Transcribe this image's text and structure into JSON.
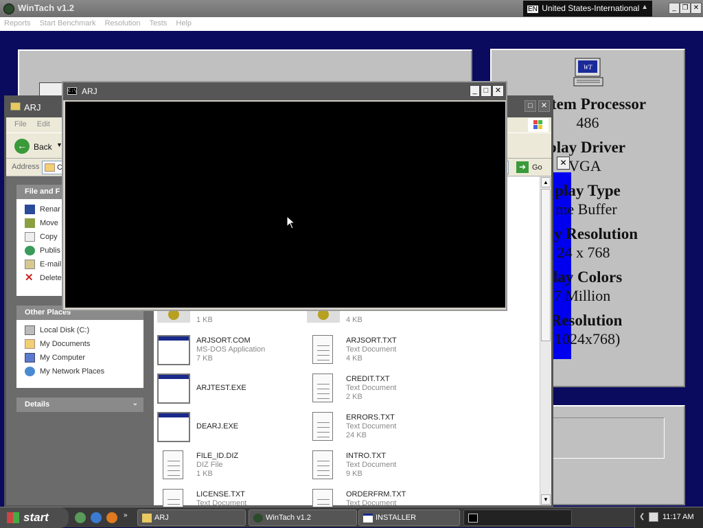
{
  "wintach": {
    "title": "WinTach v1.2",
    "language": "United States-International",
    "lang_code": "EN",
    "menu": [
      "Reports",
      "Start Benchmark",
      "Resolution",
      "Tests",
      "Help"
    ],
    "logo_text": "WT",
    "sysinfo": [
      {
        "heading": "tem Processor",
        "value": "486"
      },
      {
        "heading": "splay Driver",
        "value": "VGA"
      },
      {
        "heading": "play Type",
        "value": "me Buffer"
      },
      {
        "heading": "y Resolution",
        "value": "24 x 768"
      },
      {
        "heading": "lay Colors",
        "value": "7 Million"
      },
      {
        "heading": "Resolution",
        "value": "(1024x768)"
      }
    ]
  },
  "explorer": {
    "title": "ARJ",
    "menu": [
      "File",
      "Edit"
    ],
    "back_label": "Back",
    "address_label": "Address",
    "address_value": "C",
    "go_label": "Go",
    "file_folder_tasks": {
      "title": "File and F",
      "items": [
        "Renar",
        "Move",
        "Copy",
        "Publis",
        "E-mail",
        "Delete"
      ]
    },
    "other_places": {
      "title": "Other Places",
      "items": [
        "Local Disk (C:)",
        "My Documents",
        "My Computer",
        "My Network Places"
      ]
    },
    "details_title": "Details",
    "files": [
      {
        "name": "",
        "type": "",
        "size": "1 KB",
        "icon": "gear"
      },
      {
        "name": "",
        "type": "",
        "size": "4 KB",
        "icon": "gear"
      },
      {
        "name": "ARJSORT.COM",
        "type": "MS-DOS Application",
        "size": "7 KB",
        "icon": "exe"
      },
      {
        "name": "ARJSORT.TXT",
        "type": "Text Document",
        "size": "4 KB",
        "icon": "txt"
      },
      {
        "name": "ARJTEST.EXE",
        "type": "",
        "size": "",
        "icon": "exe"
      },
      {
        "name": "CREDIT.TXT",
        "type": "Text Document",
        "size": "2 KB",
        "icon": "txt"
      },
      {
        "name": "DEARJ.EXE",
        "type": "",
        "size": "",
        "icon": "exe"
      },
      {
        "name": "ERRORS.TXT",
        "type": "Text Document",
        "size": "24 KB",
        "icon": "txt"
      },
      {
        "name": "FILE_ID.DIZ",
        "type": "DIZ File",
        "size": "1 KB",
        "icon": "txt"
      },
      {
        "name": "INTRO.TXT",
        "type": "Text Document",
        "size": "9 KB",
        "icon": "txt"
      },
      {
        "name": "LICENSE.TXT",
        "type": "Text Document",
        "size": "",
        "icon": "txt"
      },
      {
        "name": "ORDERFRM.TXT",
        "type": "Text Document",
        "size": "",
        "icon": "txt"
      }
    ]
  },
  "console": {
    "title": "ARJ",
    "icon_text": "C:\\"
  },
  "taskbar": {
    "start_label": "start",
    "buttons": [
      "ARJ",
      "WinTach v1.2",
      "INSTALLER",
      ""
    ],
    "time": "11:17 AM"
  }
}
